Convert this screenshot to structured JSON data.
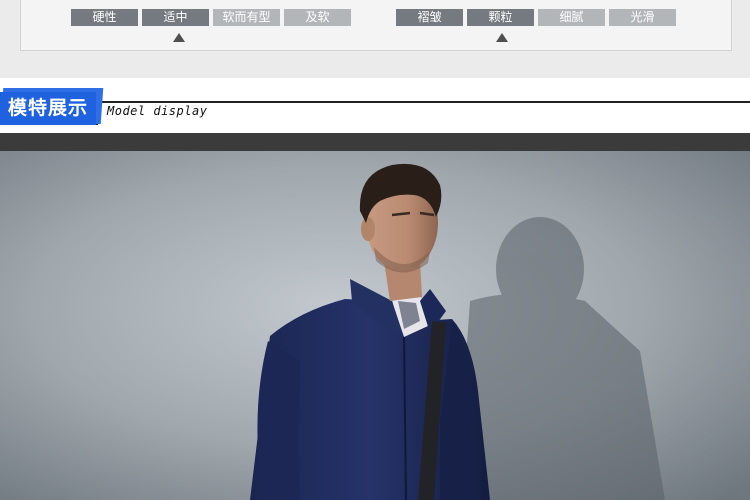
{
  "attributes": {
    "left_group": {
      "options": [
        "硬性",
        "适中",
        "软而有型",
        "及软"
      ],
      "selected_index": 1
    },
    "right_group": {
      "options": [
        "褶皱",
        "颗粒",
        "细腻",
        "光滑"
      ],
      "selected_index": 1
    }
  },
  "section": {
    "title_cn": "模特展示",
    "title_en": "Model display"
  },
  "colors": {
    "accent": "#1f62df",
    "chip_active": "#747a80",
    "chip_inactive": "#b3b6b9",
    "jacket": "#1e2a52",
    "backdrop": "#9ea5ab"
  },
  "photo": {
    "subject": "male-model-navy-jacket"
  }
}
